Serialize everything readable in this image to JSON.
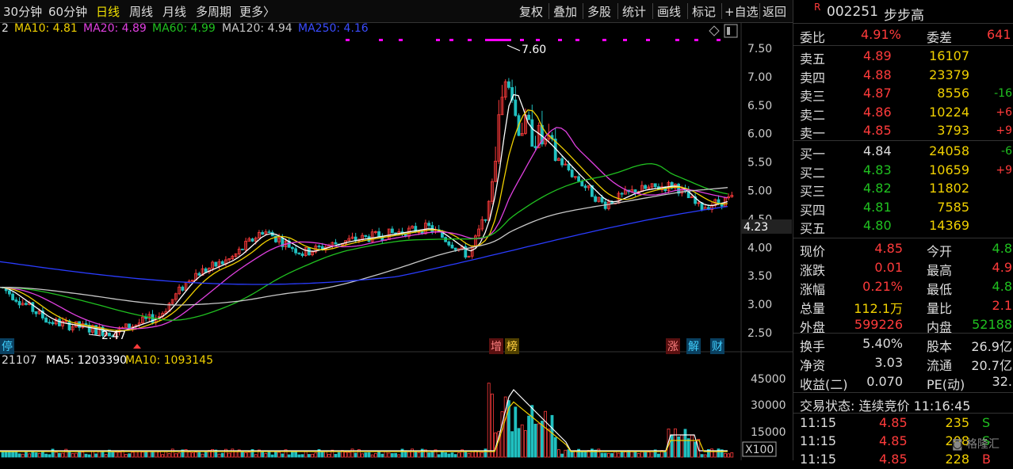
{
  "toolbar": {
    "periods": [
      "30分钟",
      "60分钟",
      "日线",
      "周线",
      "月线",
      "多周期",
      "更多〉"
    ],
    "active_period": "日线",
    "actions": [
      "复权",
      "叠加",
      "多股",
      "统计",
      "画线",
      "标记",
      "+自选",
      "返回"
    ]
  },
  "ma_legend": {
    "prefix": "2",
    "ma10": "MA10: 4.81",
    "ma20": "MA20: 4.89",
    "ma60": "MA60: 4.99",
    "ma120": "MA120: 4.94",
    "ma250": "MA250: 4.16"
  },
  "colors": {
    "up": "#ff3b3b",
    "down": "#20c0c0",
    "ma5": "#ffffff",
    "ma10": "#f0d000",
    "ma20": "#e040e0",
    "ma60": "#20c020",
    "ma120": "#c8c8c8",
    "ma250": "#2a3cff",
    "marker": "#ff00ff"
  },
  "price_chart": {
    "y_ticks": [
      "7.50",
      "7.00",
      "6.50",
      "6.00",
      "5.50",
      "5.00",
      "4.50",
      "4.00",
      "3.50",
      "3.00",
      "2.50"
    ],
    "high_label": "7.60",
    "low_label": "2.47",
    "current_price_tag": "4.23",
    "event_tags": [
      "停",
      "增",
      "榜",
      "涨",
      "解",
      "财"
    ],
    "icons": [
      "diamond-icon",
      "panel-toggle-icon"
    ]
  },
  "volume_chart": {
    "legend_prefix": "21107",
    "ma5": "MA5: 1203390",
    "ma10": "MA10: 1093145",
    "y_ticks": [
      "45000",
      "30000",
      "15000"
    ],
    "unit": "X100"
  },
  "quote": {
    "badge": "R",
    "code": "002251",
    "name": "步步高",
    "weibi_label": "委比",
    "weibi": "4.91%",
    "weicha_label": "委差",
    "weicha": "641",
    "asks": [
      {
        "label": "卖五",
        "price": "4.89",
        "vol": "16107",
        "chg": ""
      },
      {
        "label": "卖四",
        "price": "4.88",
        "vol": "23379",
        "chg": ""
      },
      {
        "label": "卖三",
        "price": "4.87",
        "vol": "8556",
        "chg": "-16"
      },
      {
        "label": "卖二",
        "price": "4.86",
        "vol": "10224",
        "chg": "+6"
      },
      {
        "label": "卖一",
        "price": "4.85",
        "vol": "3793",
        "chg": "+9"
      }
    ],
    "bids": [
      {
        "label": "买一",
        "price": "4.84",
        "vol": "24058",
        "chg": "-6"
      },
      {
        "label": "买二",
        "price": "4.83",
        "vol": "10659",
        "chg": "+9"
      },
      {
        "label": "买三",
        "price": "4.82",
        "vol": "11802",
        "chg": ""
      },
      {
        "label": "买四",
        "price": "4.81",
        "vol": "7585",
        "chg": ""
      },
      {
        "label": "买五",
        "price": "4.80",
        "vol": "14369",
        "chg": ""
      }
    ],
    "stats": [
      {
        "l1": "现价",
        "v1": "4.85",
        "c1": "#ff3b3b",
        "l2": "今开",
        "v2": "4.8",
        "c2": "#20c020"
      },
      {
        "l1": "涨跌",
        "v1": "0.01",
        "c1": "#ff3b3b",
        "l2": "最高",
        "v2": "4.9",
        "c2": "#ff3b3b"
      },
      {
        "l1": "涨幅",
        "v1": "0.21%",
        "c1": "#ff3b3b",
        "l2": "最低",
        "v2": "4.8",
        "c2": "#20c020"
      },
      {
        "l1": "总量",
        "v1": "112.1万",
        "c1": "#f0d000",
        "l2": "量比",
        "v2": "2.1",
        "c2": "#ff3b3b"
      },
      {
        "l1": "外盘",
        "v1": "599226",
        "c1": "#ff3b3b",
        "l2": "内盘",
        "v2": "52188",
        "c2": "#20c020"
      }
    ],
    "stats2": [
      {
        "l1": "换手",
        "v1": "5.40%",
        "l2": "股本",
        "v2": "26.9亿"
      },
      {
        "l1": "净资",
        "v1": "3.03",
        "l2": "流通",
        "v2": "20.7亿"
      },
      {
        "l1": "收益(二)",
        "v1": "0.070",
        "l2": "PE(动)",
        "v2": "32."
      }
    ],
    "trade_status": "交易状态: 连续竞价 11:16:45",
    "ticks": [
      {
        "time": "11:15",
        "price": "4.85",
        "vol": "235",
        "side": "S"
      },
      {
        "time": "11:15",
        "price": "4.85",
        "vol": "208",
        "side": "S"
      },
      {
        "time": "11:15",
        "price": "4.85",
        "vol": "228",
        "side": "B"
      }
    ],
    "watermark": "格隆汇"
  }
}
